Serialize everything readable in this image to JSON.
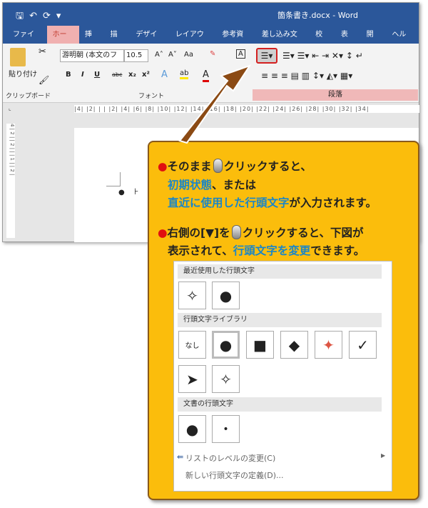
{
  "window": {
    "title": "箇条書き.docx - Word",
    "quick_access": [
      "save-icon",
      "undo-icon",
      "redo-icon",
      "customize-icon"
    ]
  },
  "tabs": [
    "ファイル",
    "ホーム",
    "挿入",
    "描画",
    "デザイン",
    "レイアウト",
    "参考資料",
    "差し込み文書",
    "校閲",
    "表示",
    "開発",
    "ヘルプ"
  ],
  "ribbon": {
    "paste": "貼り付け",
    "clipboard": "クリップボード",
    "font_name": "游明朝 (本文のフ",
    "font_size": "10.5",
    "font_group": "フォント",
    "paragraph_group": "段落",
    "case": "Aa",
    "bold": "B",
    "italic": "I",
    "underline": "U",
    "strike": "abc",
    "sub": "x₂",
    "sup": "x²"
  },
  "ruler": "|4| |2| | | |2| |4| |6| |8| |10| |12| |14| |16| |18| |20| |22| |24| |26| |28| |30| |32| |34|",
  "vruler": "4 | 2 | | 2 | | | 1 | | 2 |",
  "note": {
    "line1": [
      "そのまま",
      "クリックすると、"
    ],
    "line2": [
      "初期状態",
      "、または"
    ],
    "line3": [
      "直近に使用した行頭文字",
      "が入力されます。"
    ],
    "line4": [
      "右側の[▼]を",
      "クリックすると、下図が"
    ],
    "line5": [
      "表示されて、",
      "行頭文字を変更",
      "できます。"
    ]
  },
  "panel": {
    "recent_title": "最近使用した行頭文字",
    "recent": [
      "✧",
      "●"
    ],
    "library_title": "行頭文字ライブラリ",
    "library": [
      "なし",
      "●",
      "■",
      "◆",
      "✦",
      "✓",
      "➤",
      "✧"
    ],
    "doc_title": "文書の行頭文字",
    "doc": [
      "●",
      "•"
    ],
    "menu_level": "リストのレベルの変更(C)",
    "menu_define": "新しい行頭文字の定義(D)..."
  },
  "colors": {
    "titlebar": "#2b579a",
    "note_bg": "#fbbd0c",
    "highlight": "#1a86c8",
    "arrow": "#8b4a14"
  }
}
